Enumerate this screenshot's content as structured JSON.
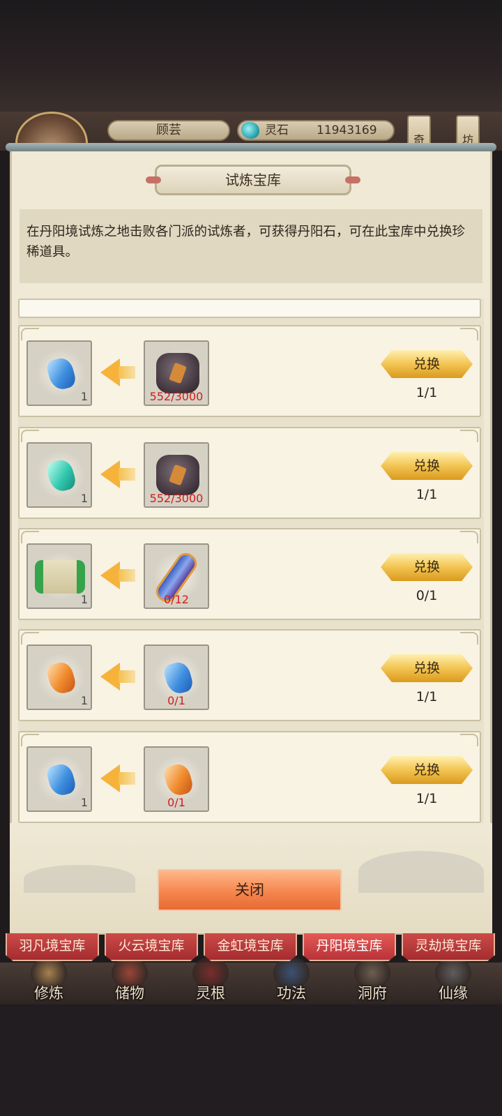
{
  "header": {
    "player_name": "顾芸",
    "currency_label": "灵石",
    "currency_value": "11943169",
    "side_tabs": [
      "奇",
      "坊"
    ]
  },
  "dialog": {
    "title": "试炼宝库",
    "description": "在丹阳境试炼之地击败各门派的试炼者，可获得丹阳石，可在此宝库中兑换珍稀道具。",
    "close_label": "关闭"
  },
  "rows": [
    {
      "reward_icon": "blue-gem-icon",
      "reward_qty": "1",
      "cost_icon": "ore-rocks-icon",
      "cost": "552/3000",
      "button": "兑换",
      "count": "1/1"
    },
    {
      "reward_icon": "teal-gem-icon",
      "reward_qty": "1",
      "cost_icon": "ore-rocks-icon",
      "cost": "552/3000",
      "button": "兑换",
      "count": "1/1"
    },
    {
      "reward_icon": "green-scroll-icon",
      "reward_qty": "1",
      "cost_icon": "blue-scroll-icon",
      "cost": "0/12",
      "button": "兑换",
      "count": "0/1"
    },
    {
      "reward_icon": "orange-gem-icon",
      "reward_qty": "1",
      "cost_icon": "blue-gem-icon",
      "cost": "0/1",
      "button": "兑换",
      "count": "1/1"
    },
    {
      "reward_icon": "blue-gem-icon",
      "reward_qty": "1",
      "cost_icon": "orange-gem-icon",
      "cost": "0/1",
      "button": "兑换",
      "count": "1/1"
    }
  ],
  "tabs": [
    {
      "label": "羽凡境宝库",
      "active": false
    },
    {
      "label": "火云境宝库",
      "active": false
    },
    {
      "label": "金虹境宝库",
      "active": false
    },
    {
      "label": "丹阳境宝库",
      "active": true
    },
    {
      "label": "灵劫境宝库",
      "active": false
    }
  ],
  "nav": [
    {
      "label": "修炼",
      "icon": "cultivation-icon"
    },
    {
      "label": "储物",
      "icon": "storage-bag-icon"
    },
    {
      "label": "灵根",
      "icon": "spirit-root-icon"
    },
    {
      "label": "功法",
      "icon": "technique-icon"
    },
    {
      "label": "洞府",
      "icon": "cave-dwelling-icon"
    },
    {
      "label": "仙缘",
      "icon": "immortal-fate-icon"
    }
  ],
  "colors": {
    "accent_red": "#d21c1c",
    "tab_red": "#b83438",
    "gold_button": "#f3c452",
    "close_button": "#f5864e"
  }
}
